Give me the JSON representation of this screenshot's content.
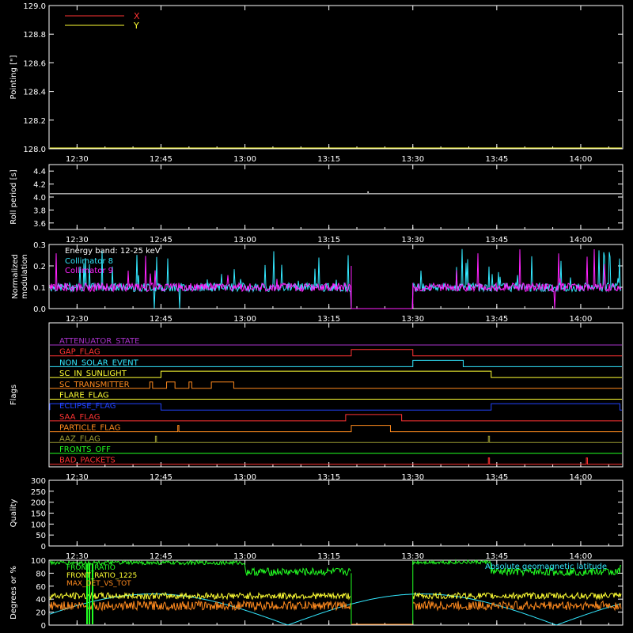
{
  "time_ticks": [
    "12:30",
    "12:45",
    "13:00",
    "13:15",
    "13:30",
    "13:45",
    "14:00"
  ],
  "colors": {
    "bg": "#000000",
    "axis": "#ffffff",
    "red": "#ff3333",
    "yellow": "#ffff33",
    "cyan": "#33e8ff",
    "magenta": "#ff22ff",
    "green": "#22ff22",
    "orange": "#ff8a1e",
    "olive": "#9a9a33",
    "blue": "#2244ff",
    "purple": "#aa33cc"
  },
  "chart_data": [
    {
      "type": "line",
      "ylabel": "Pointing [\"]",
      "ylim": [
        128.0,
        129.0
      ],
      "yticks": [
        "128.0",
        "128.2",
        "128.4",
        "128.6",
        "128.8",
        "129.0"
      ],
      "legend": [
        {
          "name": "X",
          "color": "#ff3333"
        },
        {
          "name": "Y",
          "color": "#ffff33"
        }
      ],
      "note": "X and Y traces flat at the lower axis"
    },
    {
      "type": "line",
      "ylabel": "Roll period [s]",
      "ylim": [
        3.5,
        4.5
      ],
      "yticks": [
        "3.6",
        "3.8",
        "4.0",
        "4.2",
        "4.4"
      ],
      "series": [
        {
          "name": "Roll period",
          "value": 4.05,
          "color": "#ffffff"
        }
      ]
    },
    {
      "type": "line",
      "ylabel": "Normalized modulation",
      "ylabel_lines": [
        "Normalized",
        "modulation"
      ],
      "ylim": [
        0.0,
        0.3
      ],
      "yticks": [
        "0.0",
        "0.1",
        "0.2",
        "0.3"
      ],
      "legend_title": "Energy band: 12-25 keV",
      "legend": [
        {
          "name": "Collimator 8",
          "color": "#33e8ff"
        },
        {
          "name": "Collimator 9",
          "color": "#ff22ff"
        }
      ],
      "gap": [
        "13:19",
        "13:30"
      ],
      "typical_value": 0.1
    },
    {
      "type": "line",
      "ylabel": "Flags",
      "flags": [
        {
          "name": "ATTENUATOR_STATE",
          "color": "#aa33cc",
          "high": []
        },
        {
          "name": "GAP_FLAG",
          "color": "#ff3333",
          "high": [
            [
              "13:19",
              "13:30"
            ]
          ]
        },
        {
          "name": "NON_SOLAR_EVENT",
          "color": "#33e8ff",
          "high": [
            [
              "13:30",
              "13:39"
            ]
          ]
        },
        {
          "name": "SC_IN_SUNLIGHT",
          "color": "#ffff33",
          "high": [
            [
              "12:45",
              "13:44"
            ]
          ]
        },
        {
          "name": "SC_TRANSMITTER",
          "color": "#ff8a1e",
          "high": [
            [
              "12:43",
              "12:43.5"
            ],
            [
              "12:46",
              "12:47.5"
            ],
            [
              "12:50",
              "12:50.5"
            ],
            [
              "12:54",
              "12:58"
            ]
          ]
        },
        {
          "name": "FLARE_FLAG",
          "color": "#ffff33",
          "high": []
        },
        {
          "name": "ECLIPSE_FLAG",
          "color": "#2244ff",
          "high": [
            [
              "12:25",
              "12:45"
            ],
            [
              "13:44",
              "14:07"
            ]
          ]
        },
        {
          "name": "SAA_FLAG",
          "color": "#ff3333",
          "high": [
            [
              "13:18",
              "13:28"
            ]
          ]
        },
        {
          "name": "PARTICLE_FLAG",
          "color": "#ff8a1e",
          "high": [
            [
              "13:19",
              "13:26"
            ],
            [
              "12:48",
              "12:48.2"
            ]
          ]
        },
        {
          "name": "AAZ_FLAG",
          "color": "#9a9a33",
          "high": [
            [
              "12:44",
              "12:44.2"
            ],
            [
              "13:43.5",
              "13:43.7"
            ]
          ]
        },
        {
          "name": "FRONTS_OFF",
          "color": "#22ff22",
          "high": []
        },
        {
          "name": "BAD_PACKETS",
          "color": "#ff3333",
          "high": [
            [
              "13:43.5",
              "13:43.7"
            ],
            [
              "14:01",
              "14:01.2"
            ]
          ]
        }
      ]
    },
    {
      "type": "line",
      "ylabel": "Quality",
      "ylim": [
        0,
        300
      ],
      "yticks": [
        "0",
        "50",
        "100",
        "150",
        "200",
        "250",
        "300"
      ]
    },
    {
      "type": "line",
      "ylabel": "Degrees or %",
      "ylim": [
        0,
        100
      ],
      "yticks": [
        "0",
        "20",
        "40",
        "60",
        "80",
        "100"
      ],
      "legend": [
        {
          "name": "FRONT_RATIO",
          "color": "#22ff22"
        },
        {
          "name": "FRONT_RATIO_1225",
          "color": "#ffff33"
        },
        {
          "name": "MAX_DET_VS_TOT",
          "color": "#ff8a1e"
        }
      ],
      "right_legend": {
        "name": "Absolute geomagnetic latitude",
        "color": "#33e8ff"
      },
      "gap": [
        "13:19",
        "13:30"
      ],
      "front_ratio_levels": [
        {
          "range": [
            "12:25",
            "13:00"
          ],
          "value": 96
        },
        {
          "range": [
            "13:00",
            "13:30"
          ],
          "value": 82
        },
        {
          "range": [
            "13:30",
            "13:44"
          ],
          "value": 97
        },
        {
          "range": [
            "13:44",
            "14:07"
          ],
          "value": 82
        }
      ],
      "front_ratio_1225_level": 45,
      "max_det_vs_tot_level": 30
    }
  ]
}
